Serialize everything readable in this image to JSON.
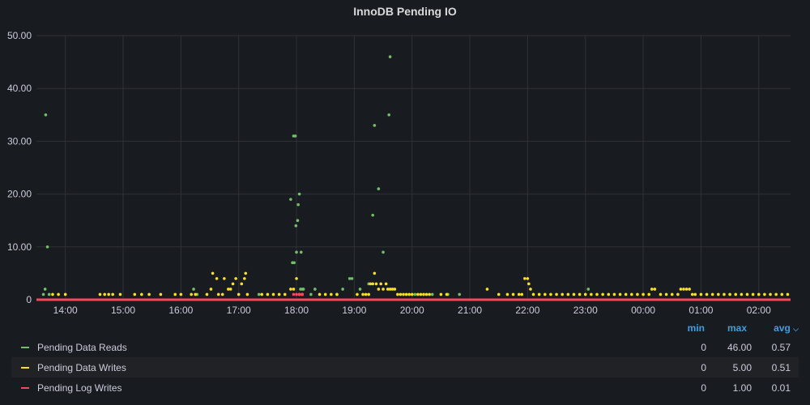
{
  "panel": {
    "title": "InnoDB Pending IO"
  },
  "legend": {
    "headers": {
      "min": "min",
      "max": "max",
      "avg": "avg",
      "sort_icon": "chevron-down-icon"
    },
    "rows": [
      {
        "name": "Pending Data Reads",
        "color": "#73bf69",
        "min": "0",
        "max": "46.00",
        "avg": "0.57"
      },
      {
        "name": "Pending Data Writes",
        "color": "#fade2a",
        "min": "0",
        "max": "5.00",
        "avg": "0.51"
      },
      {
        "name": "Pending Log Writes",
        "color": "#f2495c",
        "min": "0",
        "max": "1.00",
        "avg": "0.01"
      }
    ]
  },
  "chart_data": {
    "type": "scatter",
    "title": "InnoDB Pending IO",
    "x_unit": "hours (14.0 = 14:00, 25.0 = 01:00 next day)",
    "xlim": [
      13.5,
      26.55
    ],
    "ylim": [
      0,
      50
    ],
    "y_ticks": [
      "0",
      "10.00",
      "20.00",
      "30.00",
      "40.00",
      "50.00"
    ],
    "x_ticks": [
      {
        "label": "14:00",
        "x": 14
      },
      {
        "label": "15:00",
        "x": 15
      },
      {
        "label": "16:00",
        "x": 16
      },
      {
        "label": "17:00",
        "x": 17
      },
      {
        "label": "18:00",
        "x": 18
      },
      {
        "label": "19:00",
        "x": 19
      },
      {
        "label": "20:00",
        "x": 20
      },
      {
        "label": "21:00",
        "x": 21
      },
      {
        "label": "22:00",
        "x": 22
      },
      {
        "label": "23:00",
        "x": 23
      },
      {
        "label": "00:00",
        "x": 24
      },
      {
        "label": "01:00",
        "x": 25
      },
      {
        "label": "02:00",
        "x": 26
      }
    ],
    "grid": true,
    "series": [
      {
        "name": "Pending Data Reads",
        "color": "#73bf69",
        "points": [
          [
            13.62,
            1
          ],
          [
            13.65,
            2
          ],
          [
            13.66,
            35
          ],
          [
            13.69,
            10
          ],
          [
            13.72,
            1
          ],
          [
            16.22,
            2
          ],
          [
            16.28,
            1
          ],
          [
            17.35,
            1
          ],
          [
            17.9,
            19
          ],
          [
            17.93,
            7
          ],
          [
            17.95,
            31
          ],
          [
            17.96,
            7
          ],
          [
            17.98,
            31
          ],
          [
            17.99,
            14
          ],
          [
            18.0,
            9
          ],
          [
            18.02,
            15
          ],
          [
            18.03,
            18
          ],
          [
            18.05,
            20
          ],
          [
            18.07,
            2
          ],
          [
            18.08,
            9
          ],
          [
            18.1,
            2
          ],
          [
            18.12,
            2
          ],
          [
            18.25,
            1
          ],
          [
            18.32,
            2
          ],
          [
            18.7,
            1
          ],
          [
            18.8,
            2
          ],
          [
            18.92,
            4
          ],
          [
            18.96,
            4
          ],
          [
            19.1,
            2
          ],
          [
            19.25,
            3
          ],
          [
            19.32,
            16
          ],
          [
            19.35,
            33
          ],
          [
            19.42,
            21
          ],
          [
            19.5,
            9
          ],
          [
            19.6,
            35
          ],
          [
            19.62,
            46
          ],
          [
            20.05,
            1
          ],
          [
            20.35,
            1
          ],
          [
            20.62,
            1
          ],
          [
            20.82,
            1
          ],
          [
            23.05,
            2
          ]
        ]
      },
      {
        "name": "Pending Data Writes",
        "color": "#fade2a",
        "points": [
          [
            13.78,
            1
          ],
          [
            13.88,
            1
          ],
          [
            14.0,
            1
          ],
          [
            14.6,
            1
          ],
          [
            14.68,
            1
          ],
          [
            14.75,
            1
          ],
          [
            14.82,
            1
          ],
          [
            14.95,
            1
          ],
          [
            15.2,
            1
          ],
          [
            15.32,
            1
          ],
          [
            15.45,
            1
          ],
          [
            15.65,
            1
          ],
          [
            15.9,
            1
          ],
          [
            16.0,
            1
          ],
          [
            16.18,
            1
          ],
          [
            16.25,
            1
          ],
          [
            16.45,
            1
          ],
          [
            16.52,
            2
          ],
          [
            16.55,
            5
          ],
          [
            16.62,
            4
          ],
          [
            16.65,
            1
          ],
          [
            16.72,
            1
          ],
          [
            16.75,
            4
          ],
          [
            16.82,
            2
          ],
          [
            16.86,
            2
          ],
          [
            16.9,
            3
          ],
          [
            16.95,
            4
          ],
          [
            17.0,
            1
          ],
          [
            17.05,
            3
          ],
          [
            17.1,
            4
          ],
          [
            17.12,
            5
          ],
          [
            17.15,
            1
          ],
          [
            17.4,
            1
          ],
          [
            17.5,
            1
          ],
          [
            17.6,
            1
          ],
          [
            17.7,
            1
          ],
          [
            17.8,
            1
          ],
          [
            17.9,
            2
          ],
          [
            17.95,
            2
          ],
          [
            18.0,
            4
          ],
          [
            18.05,
            1
          ],
          [
            18.1,
            1
          ],
          [
            18.4,
            1
          ],
          [
            18.5,
            1
          ],
          [
            18.6,
            1
          ],
          [
            18.7,
            1
          ],
          [
            19.05,
            1
          ],
          [
            19.15,
            1
          ],
          [
            19.2,
            1
          ],
          [
            19.25,
            1
          ],
          [
            19.28,
            3
          ],
          [
            19.32,
            3
          ],
          [
            19.35,
            5
          ],
          [
            19.38,
            3
          ],
          [
            19.42,
            2
          ],
          [
            19.46,
            3
          ],
          [
            19.5,
            2
          ],
          [
            19.55,
            3
          ],
          [
            19.58,
            2
          ],
          [
            19.62,
            2
          ],
          [
            19.66,
            2
          ],
          [
            19.7,
            2
          ],
          [
            19.75,
            1
          ],
          [
            19.8,
            1
          ],
          [
            19.85,
            1
          ],
          [
            19.9,
            1
          ],
          [
            19.95,
            1
          ],
          [
            20.0,
            1
          ],
          [
            20.1,
            1
          ],
          [
            20.15,
            1
          ],
          [
            20.2,
            1
          ],
          [
            20.25,
            1
          ],
          [
            20.3,
            1
          ],
          [
            20.5,
            1
          ],
          [
            20.6,
            1
          ],
          [
            21.3,
            2
          ],
          [
            21.5,
            1
          ],
          [
            21.65,
            1
          ],
          [
            21.75,
            1
          ],
          [
            21.85,
            1
          ],
          [
            21.9,
            1
          ],
          [
            21.95,
            4
          ],
          [
            22.0,
            4
          ],
          [
            22.02,
            3
          ],
          [
            22.05,
            2
          ],
          [
            22.1,
            1
          ],
          [
            22.2,
            1
          ],
          [
            22.3,
            1
          ],
          [
            22.4,
            1
          ],
          [
            22.5,
            1
          ],
          [
            22.6,
            1
          ],
          [
            22.7,
            1
          ],
          [
            22.8,
            1
          ],
          [
            22.9,
            1
          ],
          [
            23.0,
            1
          ],
          [
            23.1,
            1
          ],
          [
            23.2,
            1
          ],
          [
            23.3,
            1
          ],
          [
            23.4,
            1
          ],
          [
            23.5,
            1
          ],
          [
            23.6,
            1
          ],
          [
            23.7,
            1
          ],
          [
            23.8,
            1
          ],
          [
            23.9,
            1
          ],
          [
            24.0,
            1
          ],
          [
            24.1,
            1
          ],
          [
            24.15,
            2
          ],
          [
            24.2,
            2
          ],
          [
            24.3,
            1
          ],
          [
            24.4,
            1
          ],
          [
            24.5,
            1
          ],
          [
            24.6,
            1
          ],
          [
            24.65,
            2
          ],
          [
            24.7,
            2
          ],
          [
            24.75,
            2
          ],
          [
            24.8,
            2
          ],
          [
            24.85,
            1
          ],
          [
            24.9,
            1
          ],
          [
            25.0,
            1
          ],
          [
            25.1,
            1
          ],
          [
            25.2,
            1
          ],
          [
            25.3,
            1
          ],
          [
            25.4,
            1
          ],
          [
            25.5,
            1
          ],
          [
            25.6,
            1
          ],
          [
            25.7,
            1
          ],
          [
            25.8,
            1
          ],
          [
            25.9,
            1
          ],
          [
            26.0,
            1
          ],
          [
            26.1,
            1
          ],
          [
            26.2,
            1
          ],
          [
            26.3,
            1
          ],
          [
            26.4,
            1
          ],
          [
            26.5,
            1
          ]
        ]
      },
      {
        "name": "Pending Log Writes",
        "color": "#f2495c",
        "points": [
          [
            17.95,
            1
          ],
          [
            18.0,
            1
          ],
          [
            18.05,
            1
          ],
          [
            18.1,
            1
          ]
        ]
      }
    ]
  }
}
